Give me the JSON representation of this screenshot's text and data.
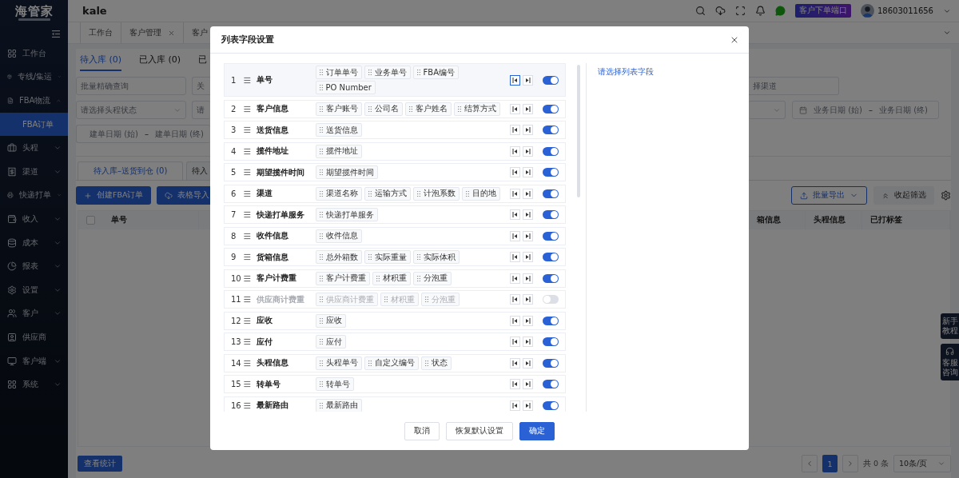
{
  "sidebar": {
    "logo": "海管家",
    "items": [
      {
        "label": "工作台",
        "kind": "link",
        "selected": false
      },
      {
        "label": "专线/集运",
        "kind": "group",
        "expanded": false,
        "selected": false
      },
      {
        "label": "FBA物流",
        "kind": "group",
        "expanded": true,
        "selected": false,
        "children": [
          {
            "label": "FBA订单",
            "selected": true
          }
        ]
      },
      {
        "label": "头程",
        "kind": "group",
        "expanded": false,
        "selected": false
      },
      {
        "label": "渠道",
        "kind": "group",
        "expanded": false,
        "selected": false
      },
      {
        "label": "快递打单",
        "kind": "group",
        "expanded": false,
        "selected": false
      },
      {
        "label": "收入",
        "kind": "group",
        "expanded": false,
        "selected": false
      },
      {
        "label": "成本",
        "kind": "group",
        "expanded": false,
        "selected": false
      },
      {
        "label": "报表",
        "kind": "group",
        "expanded": false,
        "selected": false
      },
      {
        "label": "设置",
        "kind": "group",
        "expanded": false,
        "selected": false
      },
      {
        "label": "客户",
        "kind": "group",
        "expanded": false,
        "selected": false
      },
      {
        "label": "供应商",
        "kind": "link",
        "selected": false
      },
      {
        "label": "客户端",
        "kind": "group",
        "expanded": false,
        "selected": false
      },
      {
        "label": "系统",
        "kind": "group",
        "expanded": false,
        "selected": false
      }
    ]
  },
  "header": {
    "title": "kale",
    "portal_button": "客户下单端口",
    "user": "18603011656"
  },
  "page_tabs": [
    {
      "label": "工作台",
      "closable": false
    },
    {
      "label": "客户管理",
      "closable": true
    },
    {
      "label": "客户",
      "closable": false
    }
  ],
  "status_tabs": [
    {
      "label": "待入库 (0)",
      "selected": true
    },
    {
      "label": "已入库 (0)",
      "selected": false
    },
    {
      "label": "已",
      "selected": false
    }
  ],
  "filters": {
    "batch_search": {
      "placeholder": "批量精确查询"
    },
    "keyword": {
      "placeholder": "关"
    },
    "channel": {
      "placeholder": "择渠道"
    },
    "head_status": {
      "placeholder": "请选择头程状态"
    },
    "select_4": {
      "placeholder": "请"
    },
    "created_date": {
      "start": "建单日期 (始)",
      "separator": "–",
      "end": "建单日期 (终)"
    },
    "business_date": {
      "start": "业务日期 (始)",
      "separator": "–",
      "end": "业务日期 (终)"
    }
  },
  "sub_tabs": [
    {
      "label": "待入库–送货到仓 (0)",
      "selected": true
    },
    {
      "label": "待入",
      "selected": false
    }
  ],
  "toolbar": {
    "create": "创建FBA订单",
    "import": "表格导入",
    "export": "批量导出",
    "collapse": "收起筛选"
  },
  "table": {
    "select_all": {
      "checked": false
    },
    "columns": [
      "单号",
      "箱信息",
      "头程信息",
      "已打标签"
    ]
  },
  "footer": {
    "stats_button": "查看统计",
    "pages": [
      {
        "label": "1",
        "selected": true
      }
    ],
    "total": "共 0 条",
    "page_size": "10条/页"
  },
  "float_buttons": [
    {
      "label": "新手教程",
      "kind": "text"
    },
    {
      "label": "客服咨询",
      "kind": "support"
    }
  ],
  "modal": {
    "title": "列表字段设置",
    "hint": "请选择列表字段",
    "fields": [
      {
        "index": "1",
        "name": "单号",
        "selected": true,
        "on": true,
        "chips": [
          "订单单号",
          "业务单号",
          "FBA编号",
          "PO Number"
        ]
      },
      {
        "index": "2",
        "name": "客户信息",
        "selected": false,
        "on": true,
        "chips": [
          "客户账号",
          "公司名",
          "客户姓名",
          "结算方式"
        ]
      },
      {
        "index": "3",
        "name": "送货信息",
        "selected": false,
        "on": true,
        "chips": [
          "送货信息"
        ]
      },
      {
        "index": "4",
        "name": "揽件地址",
        "selected": false,
        "on": true,
        "chips": [
          "揽件地址"
        ]
      },
      {
        "index": "5",
        "name": "期望揽件时间",
        "selected": false,
        "on": true,
        "chips": [
          "期望揽件时间"
        ]
      },
      {
        "index": "6",
        "name": "渠道",
        "selected": false,
        "on": true,
        "chips": [
          "渠道名称",
          "运输方式",
          "计泡系数",
          "目的地"
        ]
      },
      {
        "index": "7",
        "name": "快递打单服务",
        "selected": false,
        "on": true,
        "chips": [
          "快递打单服务"
        ]
      },
      {
        "index": "8",
        "name": "收件信息",
        "selected": false,
        "on": true,
        "chips": [
          "收件信息"
        ]
      },
      {
        "index": "9",
        "name": "货箱信息",
        "selected": false,
        "on": true,
        "chips": [
          "总外箱数",
          "实际重量",
          "实际体积"
        ]
      },
      {
        "index": "10",
        "name": "客户计费重",
        "selected": false,
        "on": true,
        "chips": [
          "客户计费重",
          "材积重",
          "分泡重"
        ]
      },
      {
        "index": "11",
        "name": "供应商计费重",
        "selected": false,
        "on": false,
        "chips": [
          "供应商计费重",
          "材积重",
          "分泡重"
        ]
      },
      {
        "index": "12",
        "name": "应收",
        "selected": false,
        "on": true,
        "chips": [
          "应收"
        ]
      },
      {
        "index": "13",
        "name": "应付",
        "selected": false,
        "on": true,
        "chips": [
          "应付"
        ]
      },
      {
        "index": "14",
        "name": "头程信息",
        "selected": false,
        "on": true,
        "chips": [
          "头程单号",
          "自定义编号",
          "状态"
        ]
      },
      {
        "index": "15",
        "name": "转单号",
        "selected": false,
        "on": true,
        "chips": [
          "转单号"
        ]
      },
      {
        "index": "16",
        "name": "最新路由",
        "selected": false,
        "on": true,
        "chips": [
          "最新路由"
        ]
      }
    ],
    "buttons": [
      {
        "label": "取消",
        "kind": "default"
      },
      {
        "label": "恢复默认设置",
        "kind": "default"
      },
      {
        "label": "确定",
        "kind": "primary"
      }
    ]
  }
}
